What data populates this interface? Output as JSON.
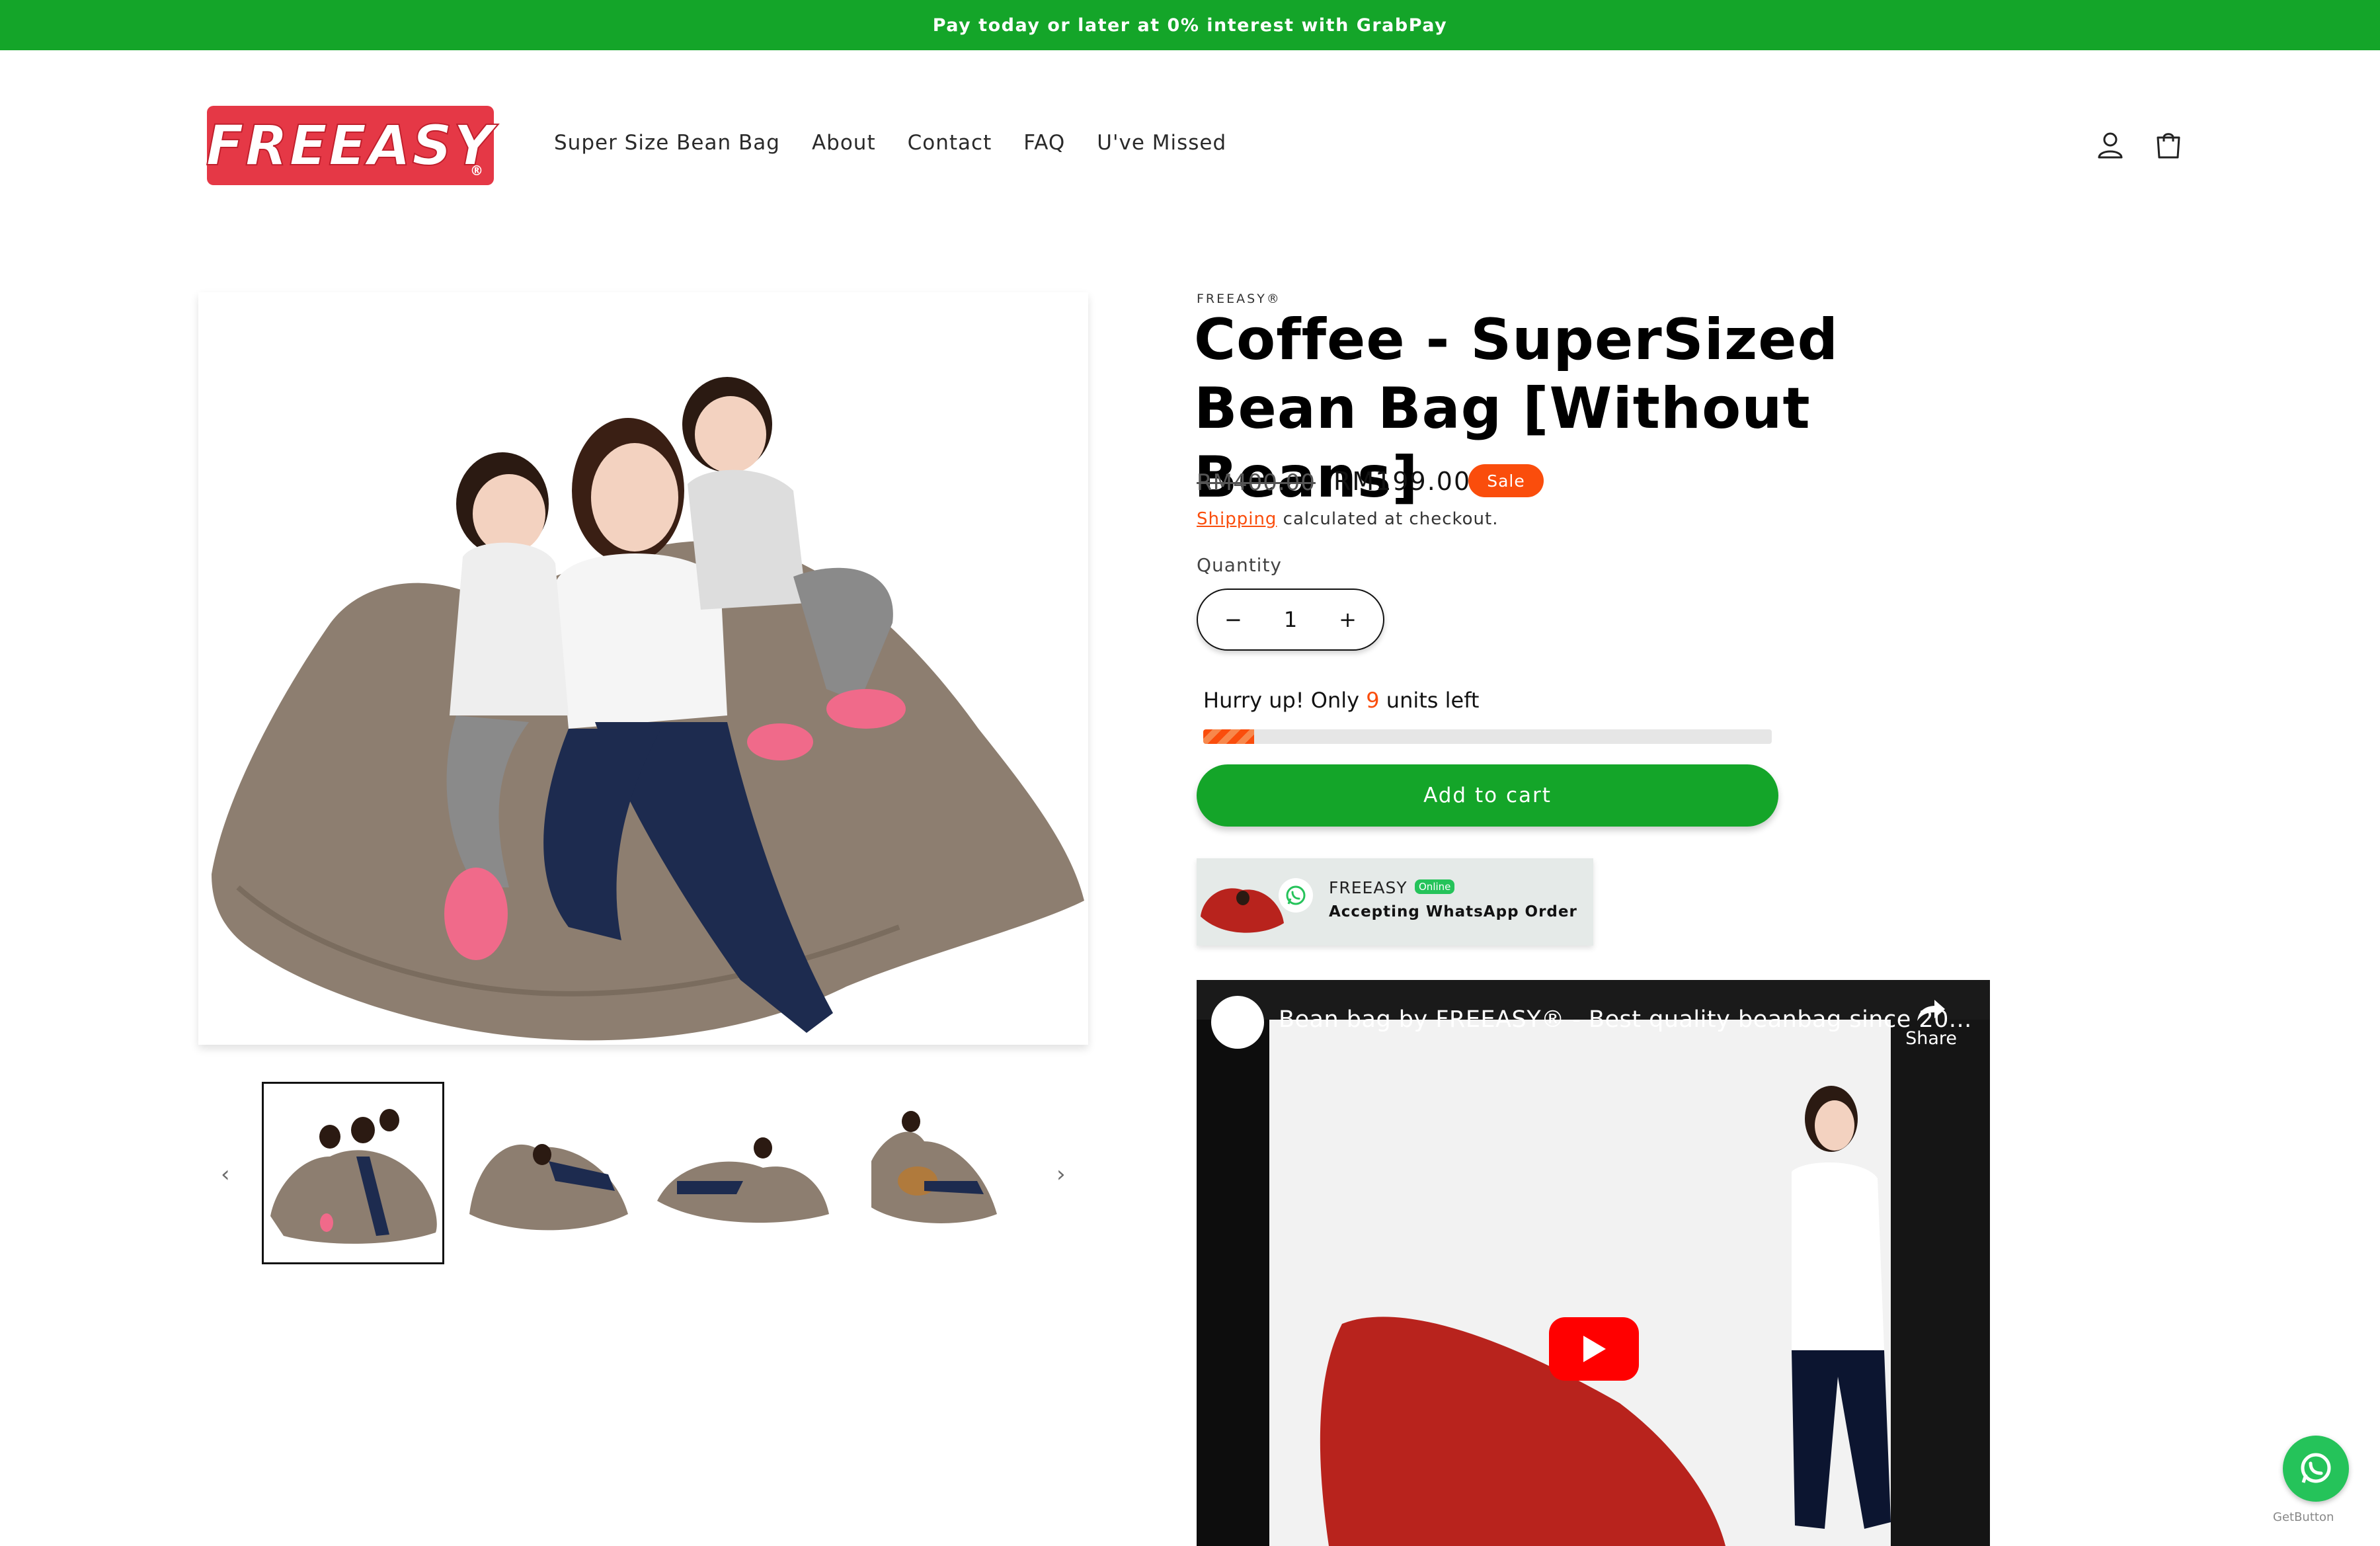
{
  "announcement": {
    "text": "Pay today or later at 0% interest with GrabPay"
  },
  "header": {
    "logo_text": "FREEASY",
    "logo_mark": "®",
    "nav": [
      {
        "label": "Super Size Bean Bag"
      },
      {
        "label": "About"
      },
      {
        "label": "Contact"
      },
      {
        "label": "FAQ"
      },
      {
        "label": "U've Missed"
      }
    ],
    "icons": [
      "account-icon",
      "cart-icon"
    ]
  },
  "product": {
    "vendor": "FREEASY®",
    "title": "Coffee - SuperSized Bean Bag [Without Beans]",
    "compare_price": "RM400.00",
    "price": "RM199.00",
    "badge": "Sale",
    "shipping_link": "Shipping",
    "shipping_text": " calculated at checkout.",
    "quantity_label": "Quantity",
    "quantity_value": "1",
    "qty_minus": "−",
    "qty_plus": "+",
    "stock": {
      "prefix": "Hurry up! Only ",
      "count": "9",
      "suffix": " units left",
      "fill_fraction": 0.09
    },
    "add_to_cart": "Add to cart"
  },
  "gallery": {
    "prev_icon": "chevron-left-icon",
    "next_icon": "chevron-right-icon",
    "thumbnail_count": 4,
    "active_index": 0
  },
  "whatsapp_card": {
    "brand": "FREEASY",
    "status": "Online",
    "message": "Accepting WhatsApp Order"
  },
  "video": {
    "title": "Bean bag by FREEASY® - Best quality beanbag since 20...",
    "share_label": "Share"
  },
  "floating": {
    "credit": "GetButton"
  },
  "colors": {
    "brand_green": "#14a529",
    "sale_orange": "#fa4d0c",
    "logo_red": "#e53846"
  }
}
